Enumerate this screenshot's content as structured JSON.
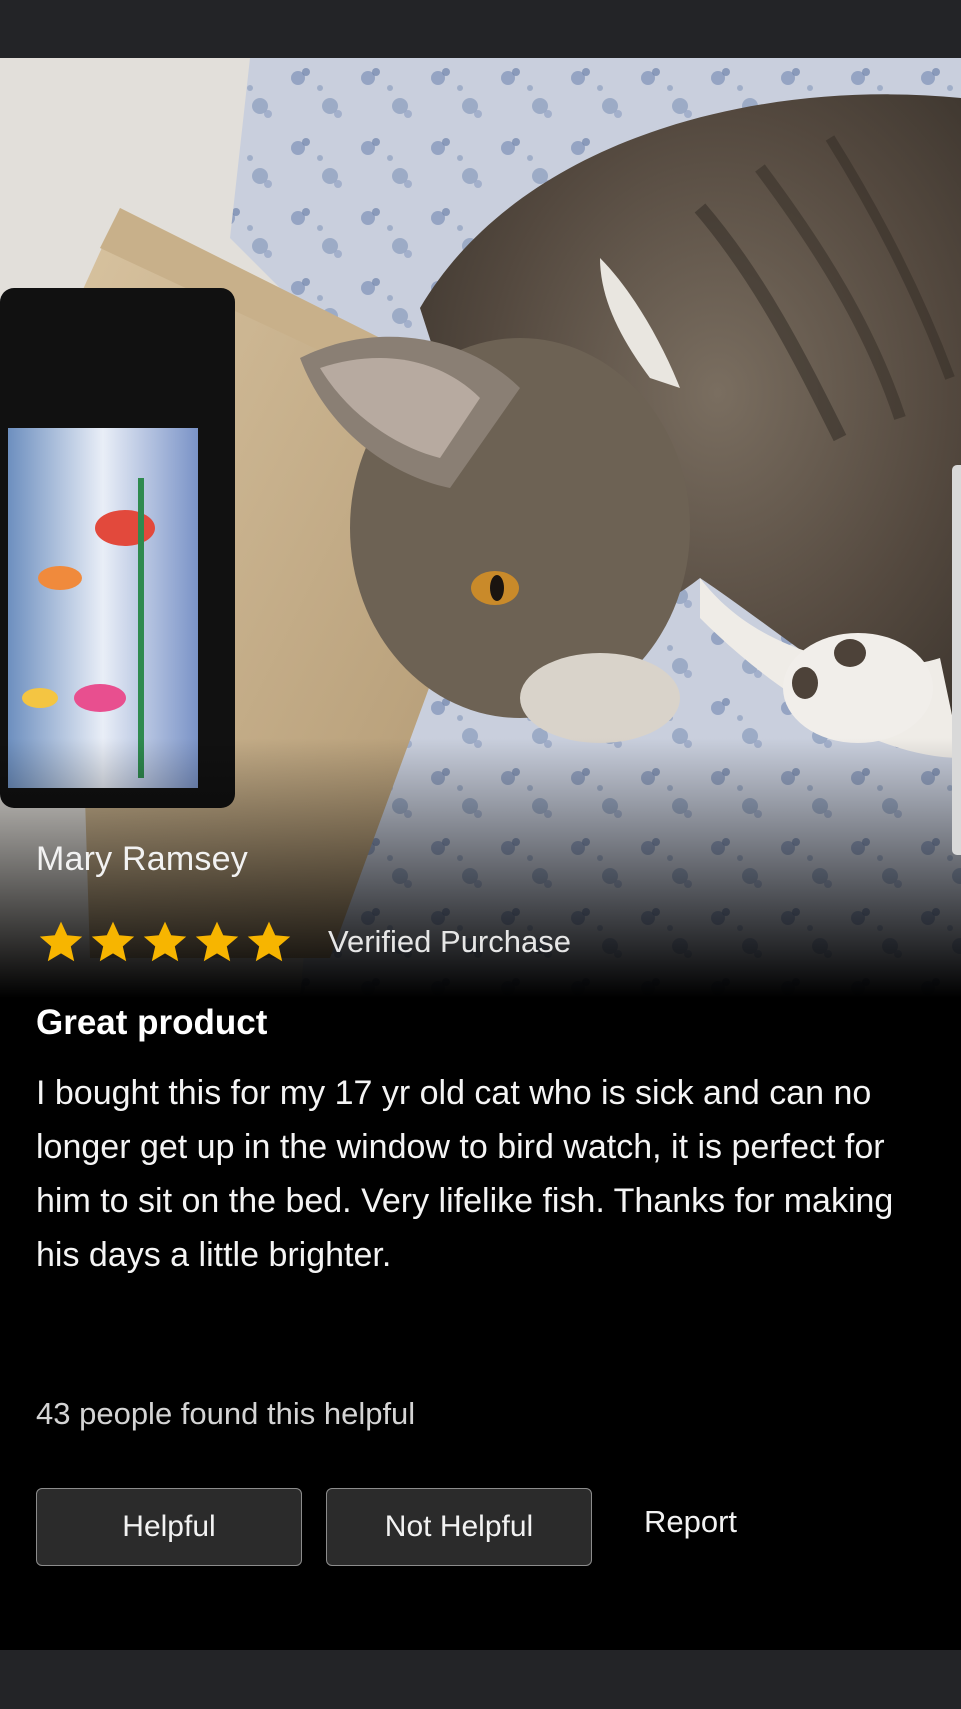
{
  "review": {
    "reviewer_name": "Mary Ramsey",
    "rating": 5,
    "rating_max": 5,
    "verified_label": "Verified Purchase",
    "title": "Great product",
    "body": "I bought this for my 17 yr old cat who is sick and can no longer get up in the window to bird watch, it is perfect for him to sit on the bed. Very lifelike fish. Thanks for making his days a little brighter.",
    "helpful_count_text": "43 people found this helpful"
  },
  "actions": {
    "helpful_label": "Helpful",
    "not_helpful_label": "Not Helpful",
    "report_label": "Report"
  },
  "colors": {
    "background": "#000000",
    "system_bar": "#232427",
    "star": "#f7b500",
    "button_bg": "#2b2b2b",
    "button_border": "#8c8c8c"
  }
}
